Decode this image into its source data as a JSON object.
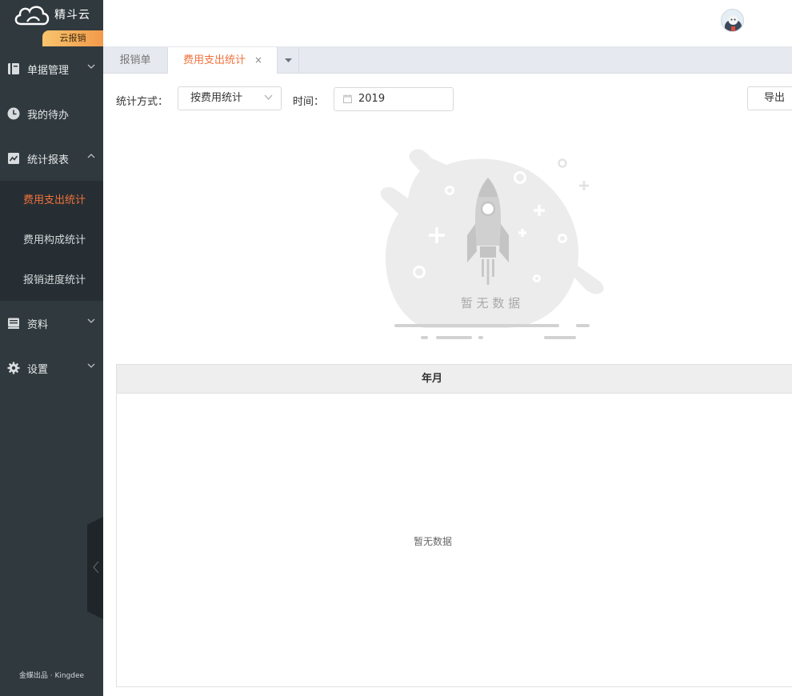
{
  "brand": {
    "name": "精斗云",
    "badge": "云报销",
    "footer": "金蝶出品 · Kingdee"
  },
  "sidebar": {
    "items": [
      {
        "label": "单据管理",
        "icon": "document-icon",
        "expanded": false
      },
      {
        "label": "我的待办",
        "icon": "clock-icon"
      },
      {
        "label": "统计报表",
        "icon": "chart-icon",
        "expanded": true,
        "children": [
          {
            "label": "费用支出统计",
            "active": true
          },
          {
            "label": "费用构成统计",
            "active": false
          },
          {
            "label": "报销进度统计",
            "active": false
          }
        ]
      },
      {
        "label": "资料",
        "icon": "book-icon",
        "expanded": false
      },
      {
        "label": "设置",
        "icon": "gear-icon",
        "expanded": false
      }
    ]
  },
  "tabs": [
    {
      "label": "报销单",
      "active": false
    },
    {
      "label": "费用支出统计",
      "active": true,
      "close": "×"
    }
  ],
  "filter": {
    "method_label": "统计方式：",
    "method_value": "按费用统计",
    "time_label": "时间：",
    "time_value": "2019",
    "export_label": "导出"
  },
  "empty": {
    "illustration_text": "暂 无 数 据"
  },
  "table": {
    "header": "年月",
    "empty_text": "暂无数据"
  },
  "colors": {
    "accent": "#f0713b",
    "sidebar": "#30393e",
    "submenu": "#272e33"
  }
}
